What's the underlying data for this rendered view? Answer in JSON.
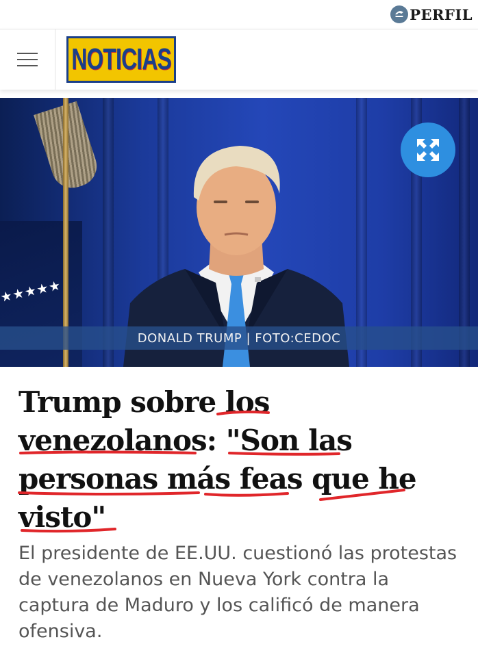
{
  "brand": {
    "name": "PERFIL"
  },
  "header": {
    "logo_text": "NOTICIAS"
  },
  "hero": {
    "caption": "DONALD TRUMP | FOTO:CEDOC"
  },
  "article": {
    "headline": "Trump sobre los venezolanos: \"Son las personas más feas que he visto\"",
    "summary": "El presidente de EE.UU. cuestionó las protestas de venezolanos en Nueva York contra la captura de Maduro y los calificó de manera ofensiva."
  },
  "colors": {
    "accent_blue": "#2e8fe0",
    "logo_yellow": "#f2c500",
    "logo_blue": "#1a3f8a",
    "annotation_red": "#e0262a"
  },
  "icons": [
    "menu-icon",
    "expand-icon",
    "perfil-logo-icon"
  ]
}
